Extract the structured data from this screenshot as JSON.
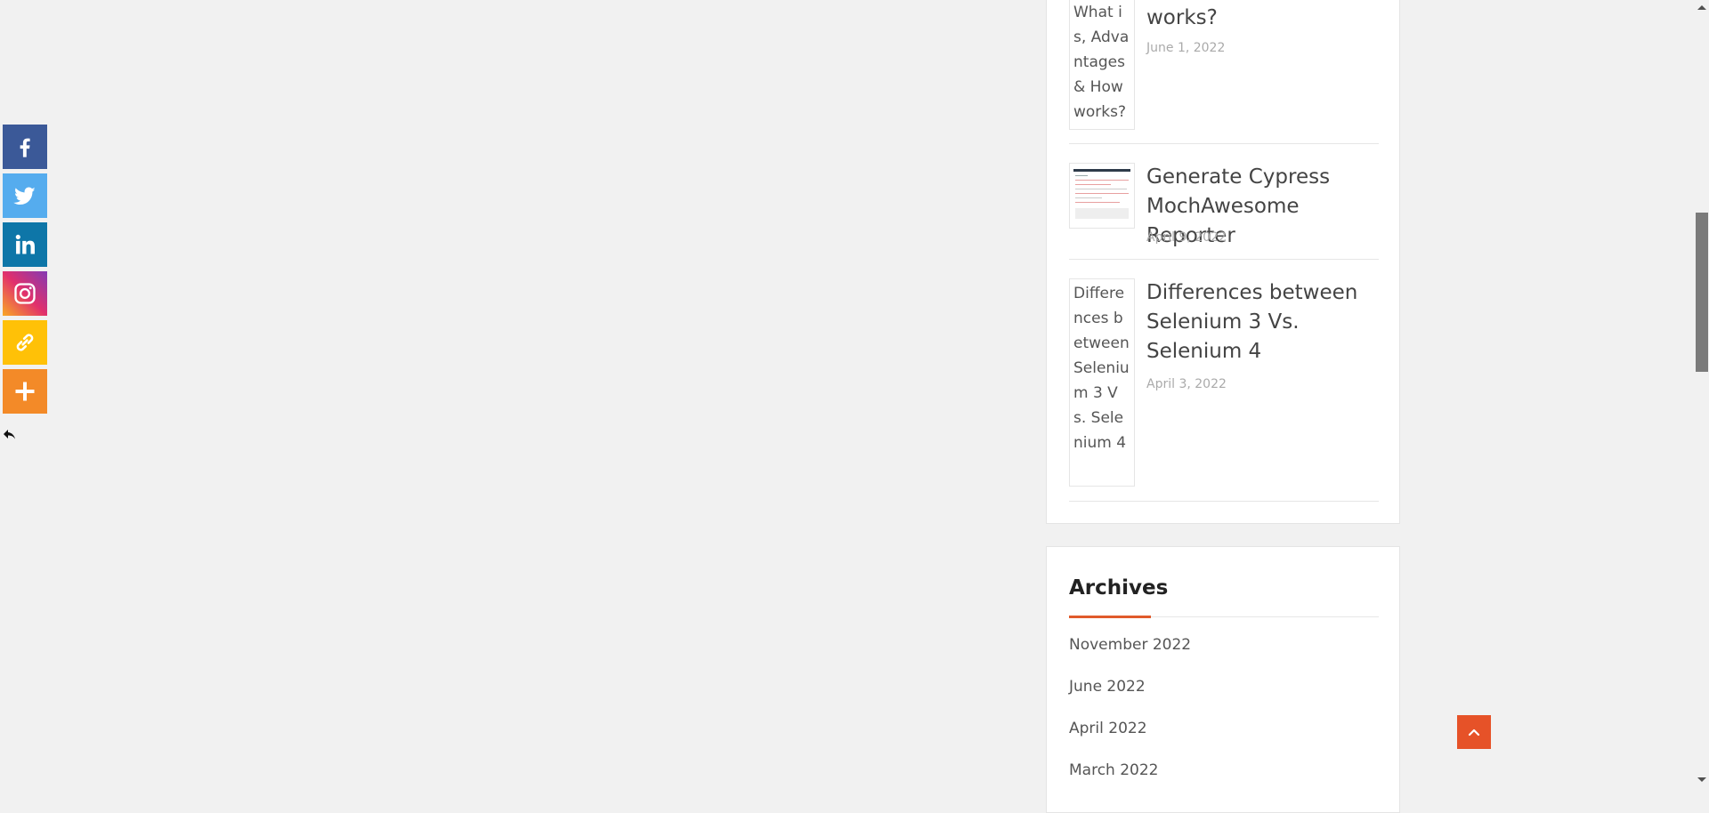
{
  "share_bar": {
    "buttons": [
      {
        "name": "facebook",
        "icon": "facebook-icon",
        "color": "#3b5998"
      },
      {
        "name": "twitter",
        "icon": "twitter-icon",
        "color": "#55acee"
      },
      {
        "name": "linkedin",
        "icon": "linkedin-icon",
        "color": "#0e76a8"
      },
      {
        "name": "instagram",
        "icon": "instagram-icon",
        "color": "#e1306c"
      },
      {
        "name": "copy-link",
        "icon": "link-icon",
        "color": "#ffc107"
      },
      {
        "name": "more",
        "icon": "plus-icon",
        "color": "#f38a28"
      }
    ],
    "hide_icon": "hide-arrow-icon"
  },
  "recent_posts": {
    "items": [
      {
        "thumb_alt": "What is, Advantages & How works?",
        "title": "works?",
        "date": "June 1, 2022"
      },
      {
        "thumb_alt": "",
        "title": "Generate Cypress MochAwesome Reporter",
        "date": "April 9, 2022"
      },
      {
        "thumb_alt": "Differences between Selenium 3 Vs. Selenium 4",
        "title": "Differences between Selenium 3 Vs. Selenium 4",
        "date": "April 3, 2022"
      }
    ]
  },
  "archives": {
    "title": "Archives",
    "items": [
      "November 2022",
      "June 2022",
      "April 2022",
      "March 2022"
    ]
  },
  "back_to_top": {
    "icon": "chevron-up-icon",
    "color": "#e65228"
  },
  "accent_color": "#e05a2b"
}
